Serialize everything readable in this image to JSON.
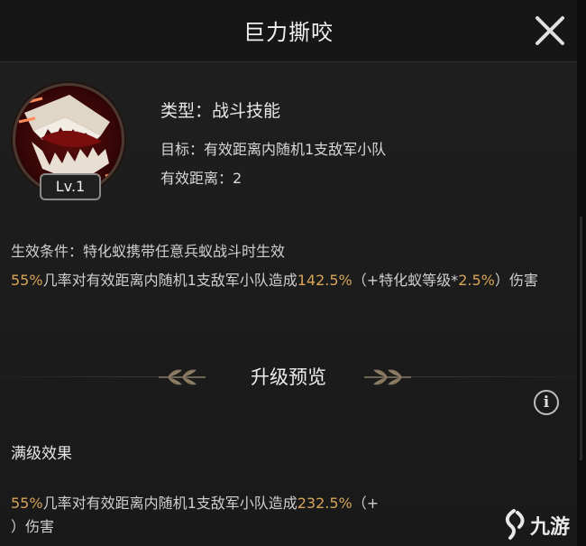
{
  "header": {
    "title": "巨力撕咬"
  },
  "skill": {
    "level": "Lv.1",
    "type": "类型：战斗技能",
    "target": "目标：有效距离内随机1支敌军小队",
    "range": "有效距离：2",
    "condition": "生效条件：特化蚁携带任意兵蚁战斗时生效",
    "effect": {
      "chance": "55%",
      "mid": "几率对有效距离内随机1支敌军小队造成",
      "dmg": "142.5%",
      "paren_open": "（+特化蚁等级*",
      "scale": "2.5%",
      "tail": "）伤害"
    }
  },
  "upgrade": {
    "section_title": "升级预览",
    "info_icon": "i",
    "max_label": "满级效果",
    "effect": {
      "chance": "55%",
      "mid": "几率对有效距离内随机1支敌军小队造成",
      "dmg": "232.5%",
      "paren_open": "（+",
      "tail": "）伤害"
    }
  },
  "watermark": {
    "text": "九游"
  },
  "colors": {
    "accent_gold": "#d8a458",
    "background": "#1b1b1b"
  }
}
